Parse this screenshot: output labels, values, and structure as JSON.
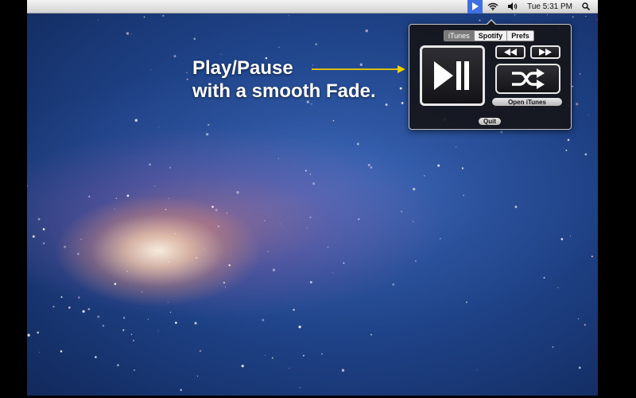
{
  "menubar": {
    "clock": "Tue 5:31 PM",
    "icons": [
      "play-icon",
      "wifi-icon",
      "volume-icon",
      "spotlight-search-icon"
    ],
    "active_color": "#3f6fe0"
  },
  "promo": {
    "line1": "Play/Pause",
    "line2": "with a smooth Fade.",
    "arrow_color": "#f2d000"
  },
  "popover": {
    "tabs": [
      {
        "label": "iTunes",
        "selected": true
      },
      {
        "label": "Spotify",
        "selected": false
      },
      {
        "label": "Prefs",
        "selected": false
      }
    ],
    "controls": {
      "play_pause_icon": "play-pause-icon",
      "rewind_icon": "rewind-icon",
      "fast_forward_icon": "fast-forward-icon",
      "shuffle_icon": "shuffle-icon"
    },
    "open_label": "Open iTunes",
    "quit_label": "Quit"
  }
}
